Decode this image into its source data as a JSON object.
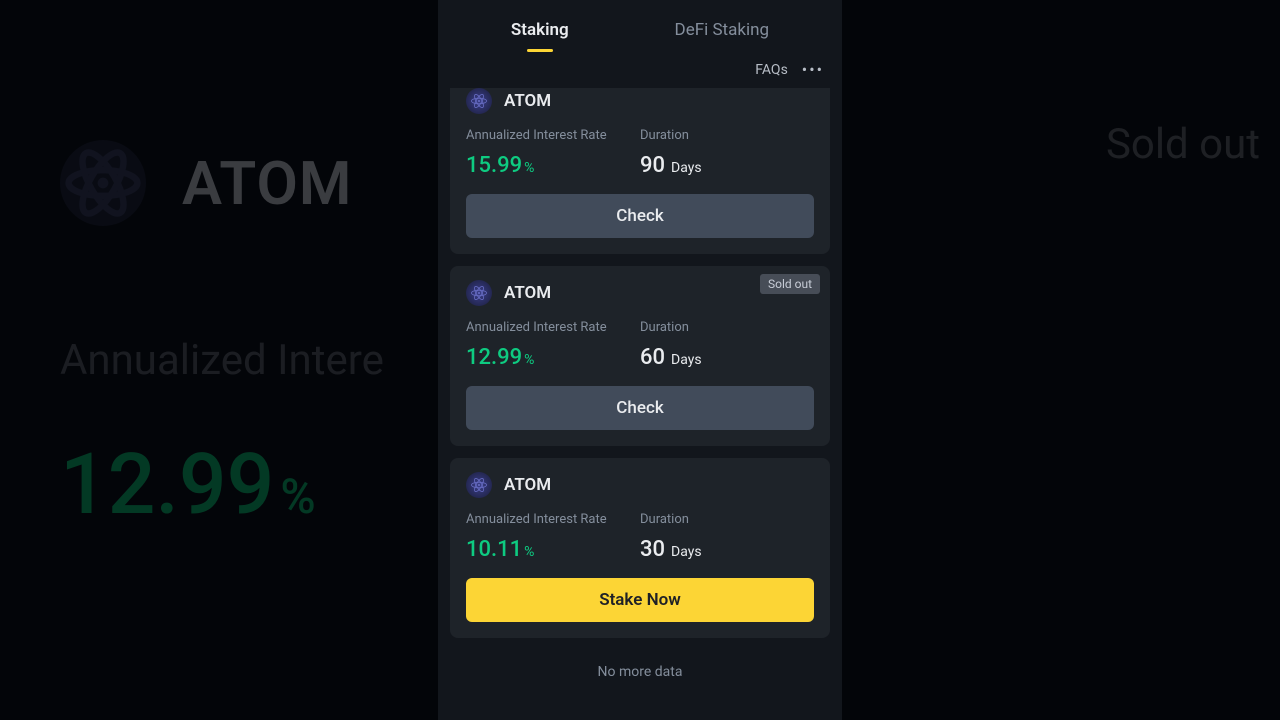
{
  "backdrop": {
    "ticker": "ATOM",
    "air_label": "Annualized Intere",
    "rate": "12.99",
    "rate_pct": "%",
    "sold_out": "Sold out"
  },
  "tabs": {
    "staking": "Staking",
    "defi": "DeFi Staking"
  },
  "subbar": {
    "faqs": "FAQs"
  },
  "labels": {
    "air": "Annualized Interest Rate",
    "duration": "Duration",
    "days": "Days",
    "pct": "%",
    "check": "Check",
    "stake_now": "Stake Now",
    "no_more": "No more data",
    "sold_out": "Sold out"
  },
  "cards": [
    {
      "ticker": "ATOM",
      "rate": "15.99",
      "duration": "90",
      "sold_out": true,
      "action": "check",
      "truncated": true
    },
    {
      "ticker": "ATOM",
      "rate": "12.99",
      "duration": "60",
      "sold_out": true,
      "action": "check",
      "truncated": false
    },
    {
      "ticker": "ATOM",
      "rate": "10.11",
      "duration": "30",
      "sold_out": false,
      "action": "stake",
      "truncated": false
    }
  ]
}
